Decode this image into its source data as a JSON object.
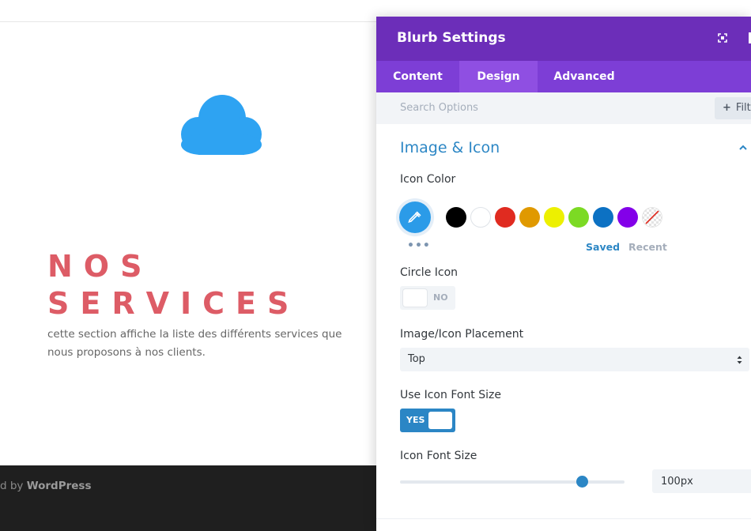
{
  "page": {
    "heading_line1": "NOS",
    "heading_line2": "SERVICES",
    "description": "cette section affiche la liste des différents services que nous proposons à nos clients.",
    "footer_prefix": "d by ",
    "footer_brand": "WordPress",
    "icon": "cloud-icon",
    "accent_color": "#dd5c66"
  },
  "modal": {
    "title": "Blurb Settings",
    "tabs": [
      {
        "label": "Content"
      },
      {
        "label": "Design"
      },
      {
        "label": "Advanced"
      }
    ],
    "active_tab": "Design",
    "search_placeholder": "Search Options",
    "filter_label": "Filt",
    "section_title": "Image & Icon",
    "icon_color": {
      "label": "Icon Color",
      "swatches": [
        "#000000",
        "#ffffff",
        "#e02b20",
        "#e09900",
        "#edf000",
        "#7cda24",
        "#0c71c3",
        "#8300e9",
        "transparent"
      ],
      "saved_label": "Saved",
      "recent_label": "Recent",
      "more_label": "•••"
    },
    "circle_icon": {
      "label": "Circle Icon",
      "state": "NO"
    },
    "placement": {
      "label": "Image/Icon Placement",
      "value": "Top"
    },
    "use_font_size": {
      "label": "Use Icon Font Size",
      "state": "YES"
    },
    "font_size": {
      "label": "Icon Font Size",
      "value": "100px",
      "slider_fraction": 0.81
    },
    "colors": {
      "header": "#6c2eb9",
      "tabs": "#7d3ed6",
      "active_tab": "#8f4fe2",
      "primary": "#2b86c5"
    }
  }
}
